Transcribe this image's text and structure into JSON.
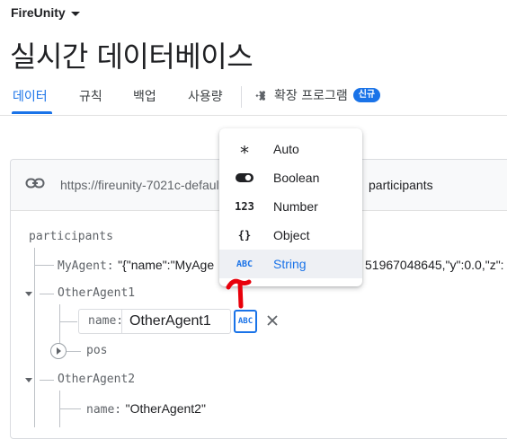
{
  "project": {
    "name": "FireUnity"
  },
  "page": {
    "title": "실시간 데이터베이스"
  },
  "tabs": [
    {
      "label": "데이터",
      "active": true
    },
    {
      "label": "규칙"
    },
    {
      "label": "백업"
    },
    {
      "label": "사용량"
    }
  ],
  "extensions_tab": {
    "label": "확장 프로그램",
    "badge": "신규"
  },
  "database": {
    "url": "https://fireunity-7021c-default-rtdb.firebaseio.com/",
    "path": "participants"
  },
  "tree": {
    "root": "participants",
    "my_agent": {
      "key": "MyAgent:",
      "value_start": "\"{\"name\":\"MyAge",
      "value_end": "51967048645,\"y\":0.0,\"z\":"
    },
    "other_agent1": {
      "key": "OtherAgent1",
      "edit": {
        "name_label": "name:",
        "value": "OtherAgent1",
        "type_icon": "ABC"
      },
      "pos_key": "pos"
    },
    "other_agent2": {
      "key": "OtherAgent2",
      "name_key": "name:",
      "name_value": "\"OtherAgent2\""
    }
  },
  "type_menu": {
    "items": [
      {
        "icon": "∗",
        "label": "Auto"
      },
      {
        "icon": "toggle",
        "label": "Boolean"
      },
      {
        "icon": "123",
        "label": "Number"
      },
      {
        "icon": "{}",
        "label": "Object"
      },
      {
        "icon": "ABC",
        "label": "String",
        "selected": true
      }
    ]
  },
  "colors": {
    "accent": "#1a73e8",
    "annotation": "#e8000b"
  }
}
